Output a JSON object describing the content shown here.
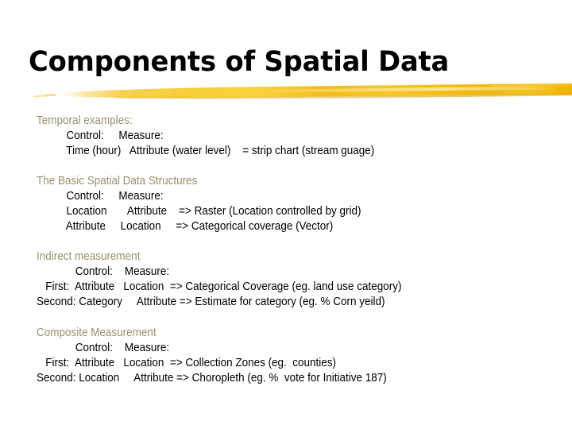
{
  "slide": {
    "title": "Components of Spatial Data",
    "background_color": "#ffffff",
    "title_color": "#000000",
    "heading_color": "#99906b",
    "body_color": "#000000",
    "accent_color": "#f5c518",
    "accent_color_dark": "#e8a800",
    "divider": "brush-stroke-underline"
  },
  "sections": [
    {
      "heading": "Temporal examples:",
      "lines": [
        "          Control:     Measure:",
        "          Time (hour)   Attribute (water level)    = strip chart (stream guage)"
      ]
    },
    {
      "heading": "The Basic Spatial Data Structures",
      "lines": [
        "          Control:     Measure:",
        "          Location       Attribute    => Raster (Location controlled by grid)",
        "          Attribute     Location     => Categorical coverage (Vector)"
      ]
    },
    {
      "heading": "Indirect measurement",
      "lines": [
        "             Control:    Measure:",
        "   First:  Attribute   Location  => Categorical Coverage (eg. land use category)",
        "Second: Category     Attribute => Estimate for category (eg. % Corn yeild)"
      ]
    },
    {
      "heading": "Composite Measurement",
      "lines": [
        "             Control:    Measure:",
        "   First:  Attribute   Location  => Collection Zones (eg.  counties)",
        "Second: Location     Attribute => Choropleth (eg. %  vote for Initiative 187)"
      ]
    }
  ]
}
